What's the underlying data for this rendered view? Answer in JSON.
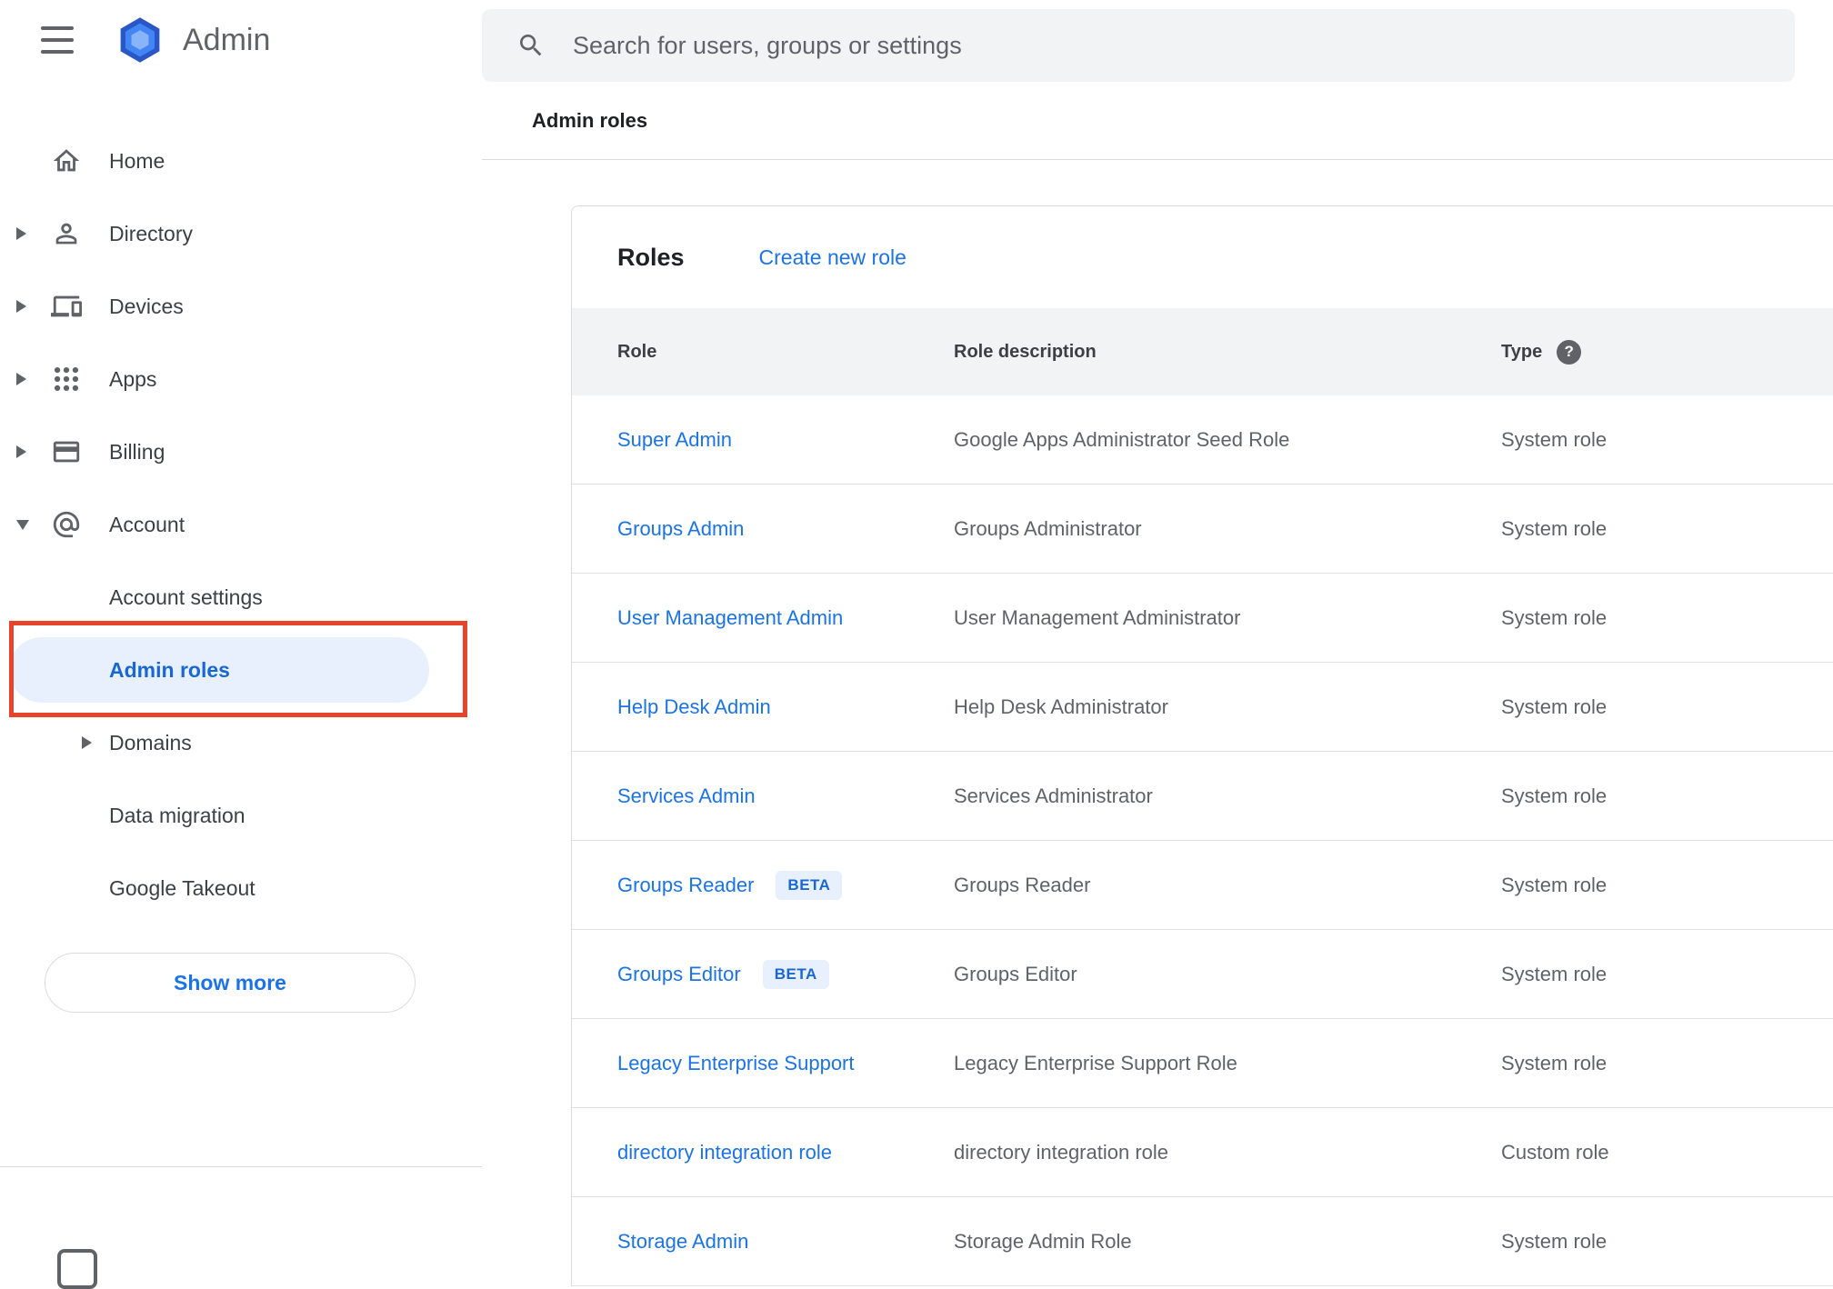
{
  "colors": {
    "accent_blue": "#1a73e8",
    "selected_text_blue": "#1967d2",
    "selected_bg_blue": "#e8f0fe",
    "annotation_red": "#e8432d",
    "band_grey": "#f1f3f4"
  },
  "header": {
    "brand": "Admin"
  },
  "search": {
    "placeholder": "Search for users, groups or settings"
  },
  "breadcrumb": "Admin roles",
  "sidebar": {
    "items": [
      {
        "label": "Home"
      },
      {
        "label": "Directory"
      },
      {
        "label": "Devices"
      },
      {
        "label": "Apps"
      },
      {
        "label": "Billing"
      },
      {
        "label": "Account"
      },
      {
        "label": "Account settings"
      },
      {
        "label": "Admin roles"
      },
      {
        "label": "Domains"
      },
      {
        "label": "Data migration"
      },
      {
        "label": "Google Takeout"
      }
    ],
    "show_more": "Show more"
  },
  "roles": {
    "title": "Roles",
    "create_link": "Create new role",
    "columns": {
      "role": "Role",
      "description": "Role description",
      "type": "Type"
    },
    "beta_badge": "BETA",
    "rows": [
      {
        "role": "Super Admin",
        "description": "Google Apps Administrator Seed Role",
        "type": "System role"
      },
      {
        "role": "Groups Admin",
        "description": "Groups Administrator",
        "type": "System role"
      },
      {
        "role": "User Management Admin",
        "description": "User Management Administrator",
        "type": "System role"
      },
      {
        "role": "Help Desk Admin",
        "description": "Help Desk Administrator",
        "type": "System role"
      },
      {
        "role": "Services Admin",
        "description": "Services Administrator",
        "type": "System role"
      },
      {
        "role": "Groups Reader",
        "description": "Groups Reader",
        "type": "System role"
      },
      {
        "role": "Groups Editor",
        "description": "Groups Editor",
        "type": "System role"
      },
      {
        "role": "Legacy Enterprise Support",
        "description": "Legacy Enterprise Support Role",
        "type": "System role"
      },
      {
        "role": "directory integration role",
        "description": "directory integration role",
        "type": "Custom role"
      },
      {
        "role": "Storage Admin",
        "description": "Storage Admin Role",
        "type": "System role"
      }
    ]
  },
  "icons": {
    "help_glyph": "?"
  }
}
